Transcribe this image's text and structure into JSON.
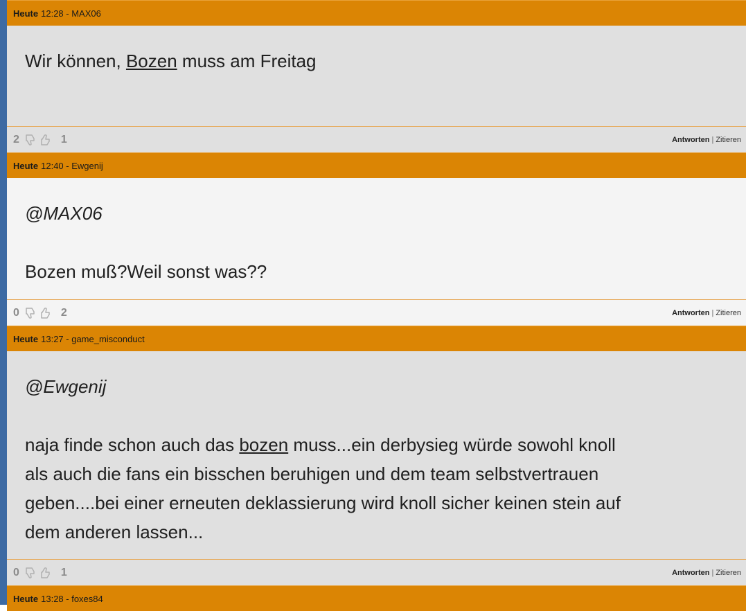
{
  "posts": [
    {
      "day": "Heute",
      "meta": "12:28 - MAX06",
      "text_before": "Wir können, ",
      "text_link": "Bozen",
      "text_after": " muss am Freitag",
      "downvotes": "2",
      "upvotes": "1"
    },
    {
      "day": "Heute",
      "meta": "12:40 - Ewgenij",
      "mention": "@MAX06",
      "text": "Bozen muß?Weil sonst was??",
      "downvotes": "0",
      "upvotes": "2"
    },
    {
      "day": "Heute",
      "meta": "13:27 - game_misconduct",
      "mention": "@Ewgenij",
      "text_before": "naja finde schon auch das ",
      "text_link": "bozen",
      "text_after_line1": " muss...ein derbysieg würde sowohl knoll",
      "line2": "als auch die fans ein bisschen beruhigen und dem team selbstvertrauen",
      "line3": "geben....bei einer erneuten deklassierung wird knoll sicher keinen stein auf",
      "line4": "dem anderen lassen...",
      "downvotes": "0",
      "upvotes": "1"
    },
    {
      "day": "Heute",
      "meta": "13:28 - foxes84"
    }
  ],
  "actions": {
    "reply": "Antworten",
    "separator": "|",
    "quote": "Zitieren"
  },
  "icons": {
    "downvote": "thumbs-down-icon",
    "upvote": "thumbs-up-icon"
  },
  "colors": {
    "header": "#db8504",
    "accent_strip": "#3d6aa3"
  }
}
